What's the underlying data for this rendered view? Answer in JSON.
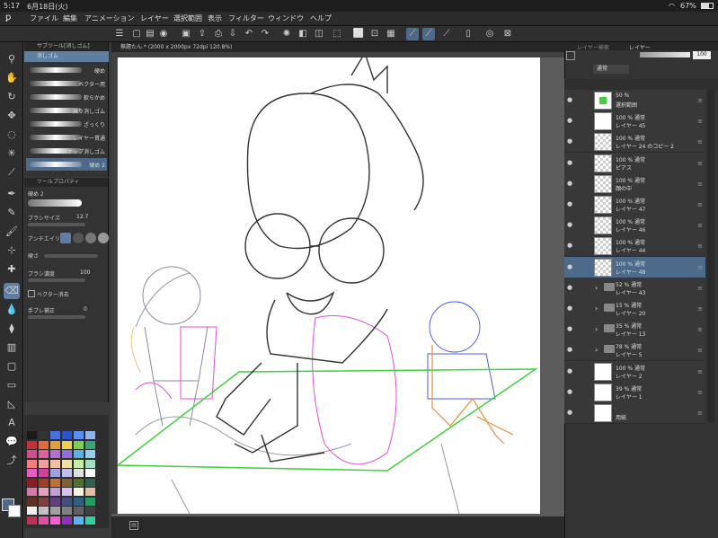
{
  "status": {
    "time": "5:17",
    "date": "6月18日(火)",
    "battery": "67%"
  },
  "menu": [
    "ファイル",
    "編集",
    "アニメーション",
    "レイヤー",
    "選択範囲",
    "表示",
    "フィルター",
    "ウィンドウ",
    "ヘルプ"
  ],
  "subtool": {
    "title": "サブツール[消しゴム]",
    "group": "消しゴム",
    "items": [
      {
        "label": "硬め",
        "selected": false
      },
      {
        "label": "ベクター用",
        "selected": false
      },
      {
        "label": "軟らかめ",
        "selected": false
      },
      {
        "label": "練り消しゴム",
        "selected": false
      },
      {
        "label": "ざっくり",
        "selected": false
      },
      {
        "label": "レイヤー貫通",
        "selected": false
      },
      {
        "label": "スナップ消しゴム",
        "selected": false
      },
      {
        "label": "硬め 2",
        "selected": true
      }
    ]
  },
  "toolprop": {
    "title": "ツールプロパティ",
    "name": "硬め 2",
    "brush_size_label": "ブラシサイズ",
    "brush_size": "12.7",
    "antialias_label": "アンチエイリアス",
    "hardness_label": "硬さ",
    "density_label": "ブラシ濃度",
    "density": "100",
    "vector_label": "ベクター消去",
    "stabilize_label": "手ブレ補正",
    "stabilize": "0"
  },
  "document": {
    "tab": "無題たん.* (2000 x 2000px 72dpi 120.8%)"
  },
  "layers_panel": {
    "tabs": [
      "レイヤー検索",
      "レイヤー"
    ],
    "blend": "通常",
    "opacity": "100",
    "layers": [
      {
        "p": "50 %",
        "n": "選択範囲",
        "thumb": "white",
        "kind": "sel"
      },
      {
        "p": "100 % 通常",
        "n": "レイヤー 45",
        "thumb": "white"
      },
      {
        "p": "100 % 通常",
        "n": "レイヤー 24 のコピー 2",
        "thumb": "chk"
      },
      {
        "p": "100 % 通常",
        "n": "ピアス",
        "thumb": "chk"
      },
      {
        "p": "100 % 通常",
        "n": "顔の中",
        "thumb": "chk"
      },
      {
        "p": "100 % 通常",
        "n": "レイヤー 47",
        "thumb": "chk"
      },
      {
        "p": "100 % 通常",
        "n": "レイヤー 46",
        "thumb": "chk"
      },
      {
        "p": "100 % 通常",
        "n": "レイヤー 44",
        "thumb": "chk"
      },
      {
        "p": "100 % 通常",
        "n": "レイヤー 48",
        "thumb": "chk",
        "selected": true
      },
      {
        "p": "52 % 通常",
        "n": "レイヤー 43",
        "kind": "folder"
      },
      {
        "p": "15 % 通常",
        "n": "レイヤー 20",
        "kind": "folder"
      },
      {
        "p": "35 % 通常",
        "n": "レイヤー 13",
        "kind": "folder"
      },
      {
        "p": "78 % 通常",
        "n": "レイヤー 5",
        "kind": "folder"
      },
      {
        "p": "100 % 通常",
        "n": "レイヤー 2",
        "thumb": "white"
      },
      {
        "p": "39 % 通常",
        "n": "レイヤー 1",
        "thumb": "white"
      },
      {
        "p": "",
        "n": "用紙",
        "thumb": "white"
      }
    ]
  },
  "colors": {
    "accent": "#4d6a8a",
    "green_guide": "#3cd23c",
    "pink": "#e04fd0",
    "blue": "#4b5ee0",
    "orange": "#f08c3c"
  }
}
